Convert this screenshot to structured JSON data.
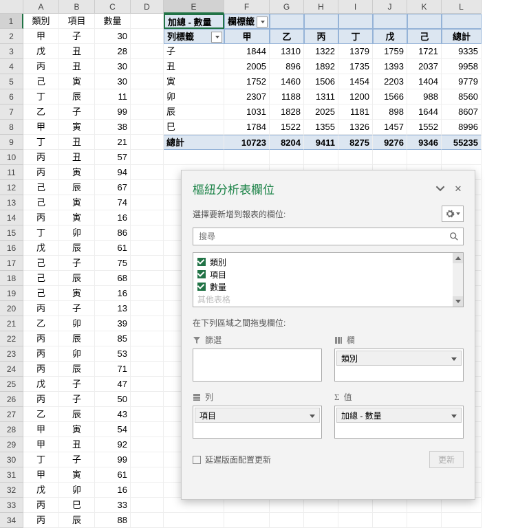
{
  "columns": [
    "A",
    "B",
    "C",
    "D",
    "E",
    "F",
    "G",
    "H",
    "I",
    "J",
    "K",
    "L"
  ],
  "raw_headers": {
    "a": "類別",
    "b": "項目",
    "c": "數量"
  },
  "raw_data": [
    [
      "甲",
      "子",
      30
    ],
    [
      "戊",
      "丑",
      28
    ],
    [
      "丙",
      "丑",
      30
    ],
    [
      "己",
      "寅",
      30
    ],
    [
      "丁",
      "辰",
      11
    ],
    [
      "乙",
      "子",
      99
    ],
    [
      "甲",
      "寅",
      38
    ],
    [
      "丁",
      "丑",
      21
    ],
    [
      "丙",
      "丑",
      57
    ],
    [
      "丙",
      "寅",
      94
    ],
    [
      "己",
      "辰",
      67
    ],
    [
      "己",
      "寅",
      74
    ],
    [
      "丙",
      "寅",
      16
    ],
    [
      "丁",
      "卯",
      86
    ],
    [
      "戊",
      "辰",
      61
    ],
    [
      "己",
      "子",
      75
    ],
    [
      "己",
      "辰",
      68
    ],
    [
      "己",
      "寅",
      16
    ],
    [
      "丙",
      "子",
      13
    ],
    [
      "乙",
      "卯",
      39
    ],
    [
      "丙",
      "辰",
      85
    ],
    [
      "丙",
      "卯",
      53
    ],
    [
      "丙",
      "辰",
      71
    ],
    [
      "戊",
      "子",
      47
    ],
    [
      "丙",
      "子",
      50
    ],
    [
      "乙",
      "辰",
      43
    ],
    [
      "甲",
      "寅",
      54
    ],
    [
      "甲",
      "丑",
      92
    ],
    [
      "丁",
      "子",
      99
    ],
    [
      "甲",
      "寅",
      61
    ],
    [
      "戊",
      "卯",
      16
    ],
    [
      "丙",
      "巳",
      33
    ],
    [
      "丙",
      "辰",
      88
    ]
  ],
  "pivot": {
    "title": "加總 - 數量",
    "col_label": "欄標籤",
    "row_label": "列標籤",
    "cols": [
      "甲",
      "乙",
      "丙",
      "丁",
      "戊",
      "己"
    ],
    "total_label": "總計",
    "rows": [
      {
        "k": "子",
        "v": [
          1844,
          1310,
          1322,
          1379,
          1759,
          1721
        ],
        "t": 9335
      },
      {
        "k": "丑",
        "v": [
          2005,
          896,
          1892,
          1735,
          1393,
          2037
        ],
        "t": 9958
      },
      {
        "k": "寅",
        "v": [
          1752,
          1460,
          1506,
          1454,
          2203,
          1404
        ],
        "t": 9779
      },
      {
        "k": "卯",
        "v": [
          2307,
          1188,
          1311,
          1200,
          1566,
          988
        ],
        "t": 8560
      },
      {
        "k": "辰",
        "v": [
          1031,
          1828,
          2025,
          1181,
          898,
          1644
        ],
        "t": 8607
      },
      {
        "k": "巳",
        "v": [
          1784,
          1522,
          1355,
          1326,
          1457,
          1552
        ],
        "t": 8996
      }
    ],
    "totals": [
      10723,
      8204,
      9411,
      8275,
      9276,
      9346,
      55235
    ]
  },
  "pane": {
    "title": "樞紐分析表欄位",
    "choose_label": "選擇要新增到報表的欄位:",
    "search_placeholder": "搜尋",
    "fields": [
      "類別",
      "項目",
      "數量"
    ],
    "more_fields": "其他表格",
    "drag_label": "在下列區域之間拖曳欄位:",
    "filter": "篩選",
    "columns": "欄",
    "rows": "列",
    "values": "值",
    "col_item": "類別",
    "row_item": "項目",
    "val_item": "加總 - 數量",
    "defer": "延遲版面配置更新",
    "update": "更新"
  }
}
